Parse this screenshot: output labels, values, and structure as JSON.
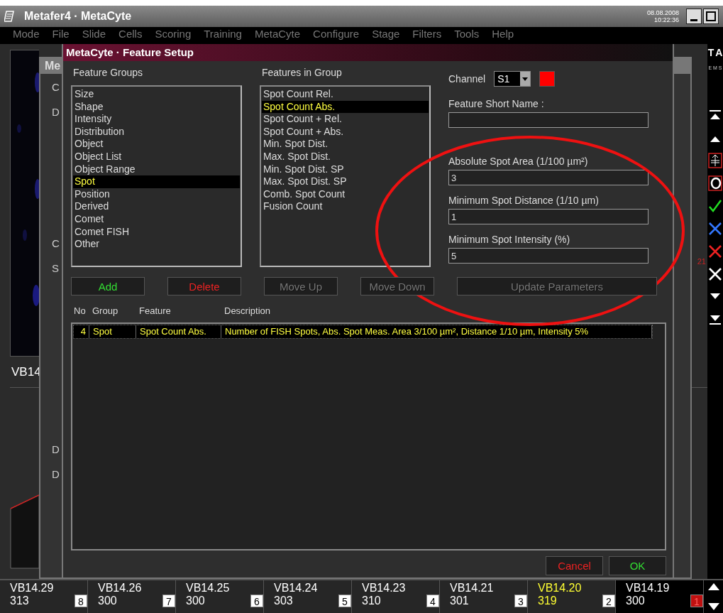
{
  "app": {
    "title": "Metafer4 · MetaCyte",
    "date": "08.08.2008",
    "time": "10:22:36"
  },
  "menu": [
    "Mode",
    "File",
    "Slide",
    "Cells",
    "Scoring",
    "Training",
    "MetaCyte",
    "Configure",
    "Stage",
    "Filters",
    "Tools",
    "Help"
  ],
  "background_window": {
    "title": "Me",
    "labels": [
      "C",
      "D",
      "C",
      "S",
      "D",
      "D"
    ],
    "side_label": "VB14"
  },
  "toolbar": {
    "letters": [
      "T",
      "A"
    ],
    "scale": "E M S",
    "count": "21"
  },
  "dialog": {
    "title": "MetaCyte · Feature Setup",
    "groups": {
      "heading": "Feature Groups",
      "items": [
        {
          "label": "Size",
          "selected": false
        },
        {
          "label": "Shape",
          "selected": false
        },
        {
          "label": "Intensity",
          "selected": false
        },
        {
          "label": "Distribution",
          "selected": false
        },
        {
          "label": "Object",
          "selected": false
        },
        {
          "label": "Object List",
          "selected": false
        },
        {
          "label": "Object Range",
          "selected": false
        },
        {
          "label": "Spot",
          "selected": true
        },
        {
          "label": "Position",
          "selected": false
        },
        {
          "label": "Derived",
          "selected": false
        },
        {
          "label": "Comet",
          "selected": false
        },
        {
          "label": "Comet FISH",
          "selected": false
        },
        {
          "label": "Other",
          "selected": false
        }
      ]
    },
    "features": {
      "heading": "Features in Group",
      "items": [
        {
          "label": "Spot Count Rel.",
          "selected": false
        },
        {
          "label": "Spot Count Abs.",
          "selected": true
        },
        {
          "label": "Spot Count + Rel.",
          "selected": false
        },
        {
          "label": "Spot Count + Abs.",
          "selected": false
        },
        {
          "label": "Min. Spot Dist.",
          "selected": false
        },
        {
          "label": "Max. Spot Dist.",
          "selected": false
        },
        {
          "label": "Min. Spot Dist. SP",
          "selected": false
        },
        {
          "label": "Max. Spot Dist. SP",
          "selected": false
        },
        {
          "label": "Comb. Spot Count",
          "selected": false
        },
        {
          "label": "Fusion Count",
          "selected": false
        }
      ]
    },
    "channel": {
      "label": "Channel",
      "value": "S1",
      "color": "#ff0000"
    },
    "fields": [
      {
        "label": "Feature Short Name :"
      },
      {
        "label": "Absolute Spot Area (1/100 µm²)",
        "value": "3"
      },
      {
        "label": "Minimum Spot Distance (1/10 µm)",
        "value": "1"
      },
      {
        "label": "Minimum Spot Intensity (%)",
        "value": "5"
      }
    ],
    "buttons": [
      {
        "label": "Add",
        "kind": "add",
        "disabled": false
      },
      {
        "label": "Delete",
        "kind": "delete",
        "disabled": false
      },
      {
        "label": "Move Up",
        "kind": "plain",
        "disabled": true
      },
      {
        "label": "Move Down",
        "kind": "plain",
        "disabled": true
      },
      {
        "label": "Update Parameters",
        "kind": "wide",
        "disabled": true
      }
    ],
    "table": {
      "columns": [
        "No",
        "Group",
        "Feature",
        "Description"
      ],
      "rows": [
        {
          "cells": [
            "4",
            "Spot",
            "Spot Count Abs.",
            "Number of FISH Spots, Abs. Spot Meas. Area 3/100 µm², Distance 1/10 µm, Intensity 5%"
          ],
          "selected": true
        }
      ]
    },
    "footer": [
      {
        "label": "Cancel",
        "kind": "delete"
      },
      {
        "label": "OK",
        "kind": "add"
      }
    ]
  },
  "slides": [
    {
      "name": "VB14.29",
      "count": "313",
      "number": "8",
      "selected": false,
      "current": false
    },
    {
      "name": "VB14.26",
      "count": "300",
      "number": "7",
      "selected": false,
      "current": false
    },
    {
      "name": "VB14.25",
      "count": "300",
      "number": "6",
      "selected": false,
      "current": false
    },
    {
      "name": "VB14.24",
      "count": "303",
      "number": "5",
      "selected": false,
      "current": false
    },
    {
      "name": "VB14.23",
      "count": "310",
      "number": "4",
      "selected": false,
      "current": false
    },
    {
      "name": "VB14.21",
      "count": "301",
      "number": "3",
      "selected": false,
      "current": false
    },
    {
      "name": "VB14.20",
      "count": "319",
      "number": "2",
      "selected": true,
      "current": false
    },
    {
      "name": "VB14.19",
      "count": "300",
      "number": "1",
      "selected": false,
      "current": true
    }
  ]
}
